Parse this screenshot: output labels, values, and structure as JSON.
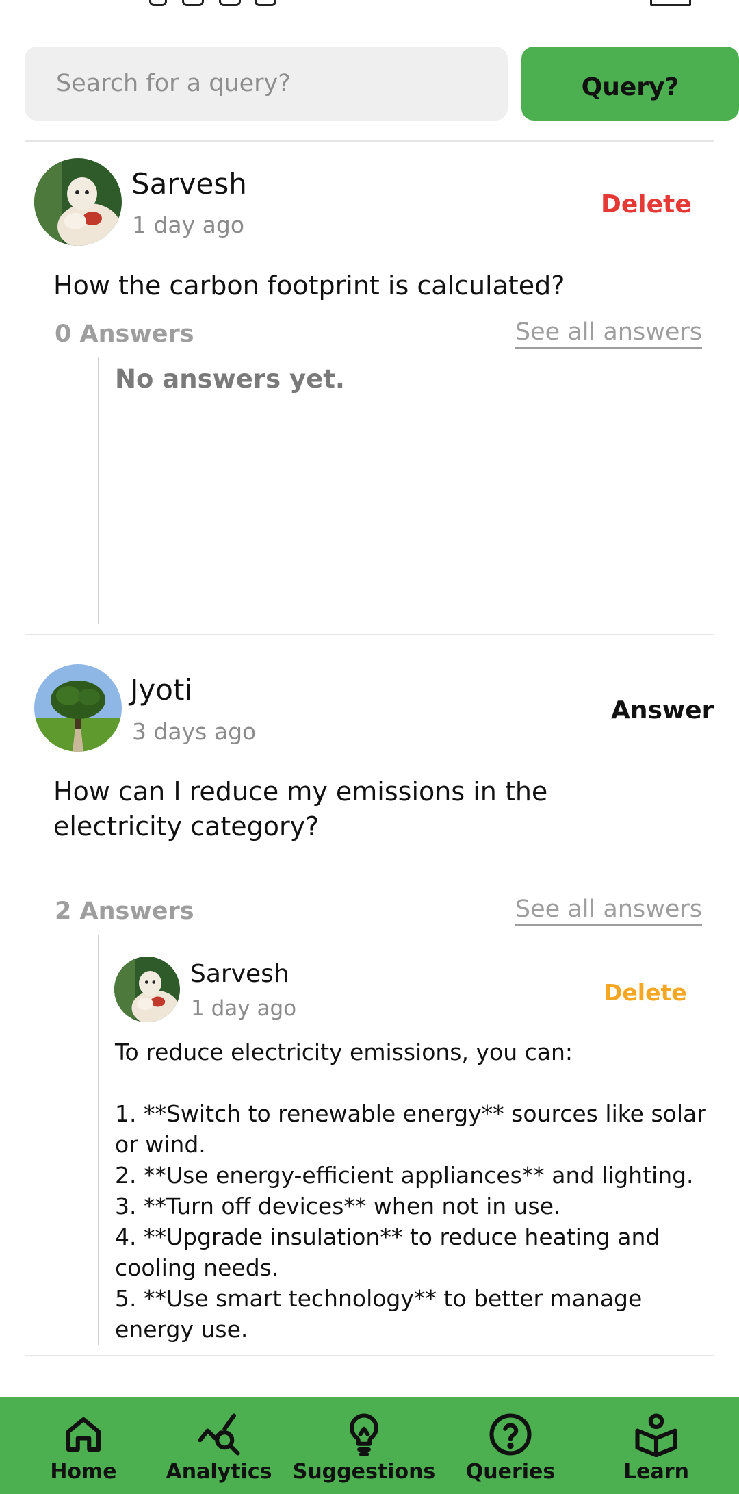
{
  "search": {
    "placeholder": "Search for a query?",
    "button_label": "Query?"
  },
  "posts": [
    {
      "author": "Sarvesh",
      "time": "1 day ago",
      "action": "Delete",
      "action_color": "#e53935",
      "question": "How the carbon footprint is calculated?",
      "answers_count": "0 Answers",
      "see_all": "See all answers",
      "empty_text": "No answers yet."
    },
    {
      "author": "Jyoti",
      "time": "3 days ago",
      "action": "Answer",
      "action_color": "#111111",
      "question": "How can I reduce my emissions in the electricity category?",
      "answers_count": "2 Answers",
      "see_all": "See all answers",
      "replies": [
        {
          "author": "Sarvesh",
          "time": "1 day ago",
          "action": "Delete",
          "action_color": "#f5a623",
          "intro": "To reduce electricity emissions, you can:",
          "items": [
            "1. **Switch to renewable energy** sources like solar or wind.",
            "2. **Use energy-efficient appliances** and lighting.",
            "3. **Turn off devices** when not in use.",
            "4. **Upgrade insulation** to reduce heating and cooling needs.",
            "5. **Use smart technology** to better manage energy use."
          ]
        }
      ]
    }
  ],
  "nav": [
    {
      "label": "Home",
      "icon": "home-icon"
    },
    {
      "label": "Analytics",
      "icon": "analytics-icon"
    },
    {
      "label": "Suggestions",
      "icon": "lightbulb-icon"
    },
    {
      "label": "Queries",
      "icon": "question-circle-icon"
    },
    {
      "label": "Learn",
      "icon": "book-reader-icon"
    }
  ],
  "colors": {
    "brand_green": "#4caf50",
    "delete_red": "#e53935",
    "delete_amber": "#f5a623",
    "muted": "#9e9e9e"
  }
}
